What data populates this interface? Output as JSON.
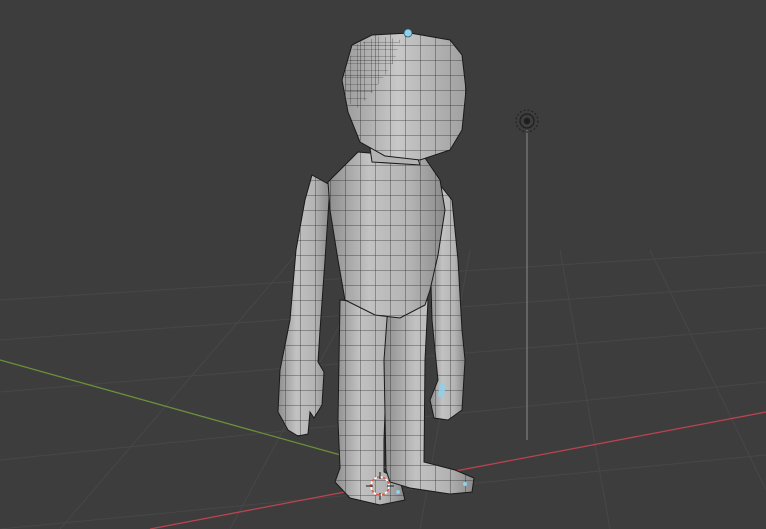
{
  "viewport": {
    "background_color": "#3d3d3d",
    "grid_color": "#484848",
    "x_axis_color": "#b9434f",
    "y_axis_color": "#6b8f3a",
    "mesh_fill_color": "#bdbdbd",
    "mesh_shade_color": "#9a9a9a",
    "wire_color": "#1a1a1a",
    "selected_vertex_color": "#8fd0ea",
    "light_line_color": "#8a8a8a",
    "cursor_colors": [
      "#e05a4a",
      "#ffffff"
    ]
  },
  "icons": {
    "light": "light-lamp-icon",
    "cursor": "3d-cursor-icon"
  }
}
